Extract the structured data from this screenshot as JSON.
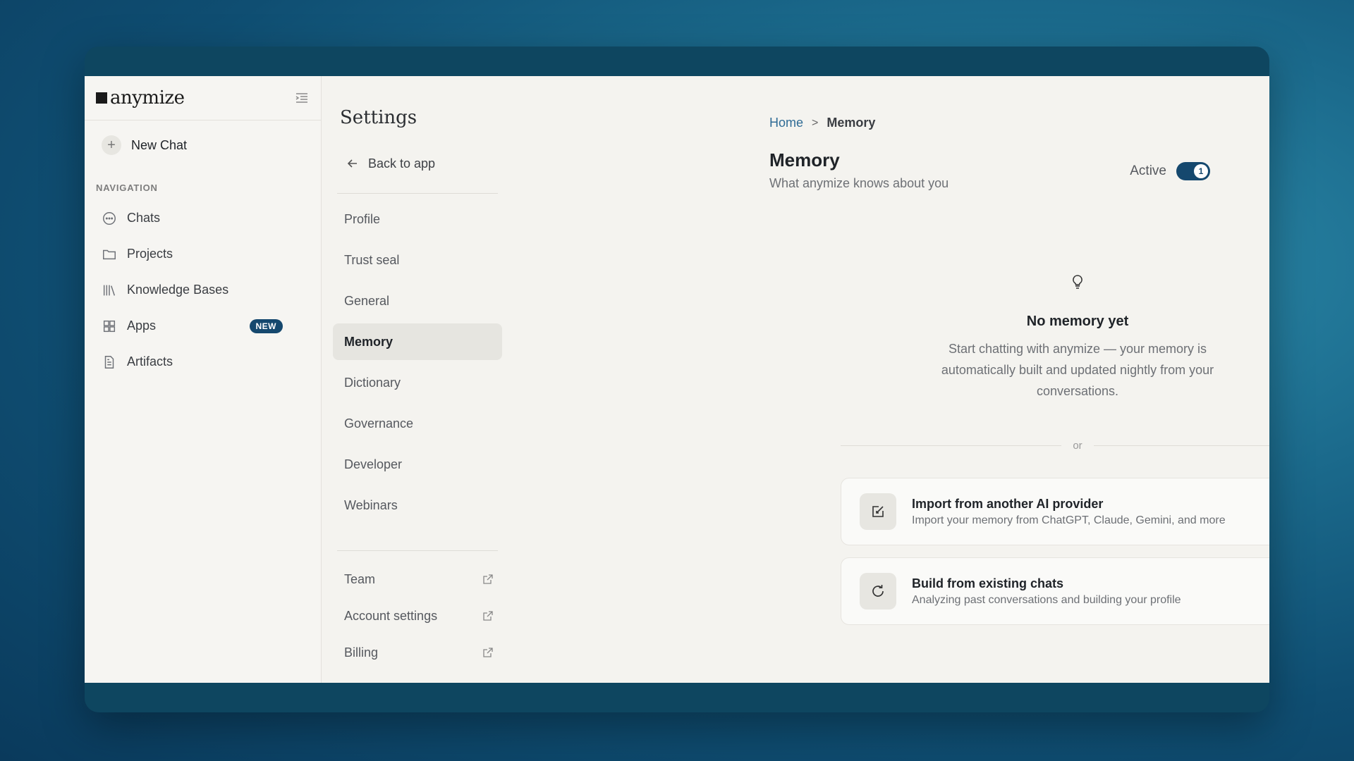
{
  "brand": {
    "name": "anymize"
  },
  "sidebar": {
    "new_chat": "New Chat",
    "section_label": "NAVIGATION",
    "items": [
      {
        "label": "Chats",
        "icon": "chat-bubble-icon"
      },
      {
        "label": "Projects",
        "icon": "folder-icon"
      },
      {
        "label": "Knowledge Bases",
        "icon": "library-icon"
      },
      {
        "label": "Apps",
        "icon": "grid-icon",
        "badge": "NEW"
      },
      {
        "label": "Artifacts",
        "icon": "document-icon"
      }
    ]
  },
  "settings": {
    "title": "Settings",
    "back": "Back to app",
    "items": [
      "Profile",
      "Trust seal",
      "General",
      "Memory",
      "Dictionary",
      "Governance",
      "Developer",
      "Webinars"
    ],
    "active": "Memory",
    "external": [
      "Team",
      "Account settings",
      "Billing"
    ]
  },
  "main": {
    "breadcrumb": {
      "home": "Home",
      "sep": ">",
      "current": "Memory"
    },
    "title": "Memory",
    "subtitle": "What anymize knows about you",
    "toggle": {
      "label": "Active",
      "knob": "1",
      "on": true
    },
    "empty": {
      "title": "No memory yet",
      "text": "Start chatting with anymize — your memory is automatically built and updated nightly from your conversations."
    },
    "or": "or",
    "cards": [
      {
        "title": "Import from another AI provider",
        "sub": "Import your memory from ChatGPT, Claude, Gemini, and more",
        "icon": "import-icon"
      },
      {
        "title": "Build from existing chats",
        "sub": "Analyzing past conversations and building your profile",
        "icon": "refresh-icon"
      }
    ]
  },
  "colors": {
    "accent": "#15486e",
    "link": "#2f6b95",
    "background": "#f4f3ef"
  }
}
